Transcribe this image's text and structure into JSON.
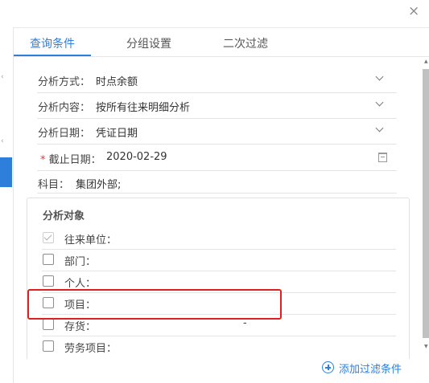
{
  "dialog": {
    "close_glyph": "×"
  },
  "tabs": [
    {
      "label": "查询条件",
      "active": true
    },
    {
      "label": "分组设置",
      "active": false
    },
    {
      "label": "二次过滤",
      "active": false
    }
  ],
  "form": {
    "rows": [
      {
        "label": "分析方式：",
        "value": "时点余额",
        "control": "dropdown"
      },
      {
        "label": "分析内容：",
        "value": "按所有往来明细分析",
        "control": "dropdown"
      },
      {
        "label": "分析日期：",
        "value": "凭证日期",
        "control": "dropdown"
      },
      {
        "required_mark": "*",
        "label": "截止日期：",
        "value": "2020-02-29",
        "control": "date",
        "icon": "calendar-icon"
      },
      {
        "label": "科目：",
        "value": "集团外部;",
        "control": "text"
      }
    ]
  },
  "analysis_objects": {
    "title": "分析对象",
    "items": [
      {
        "label": "往来单位：",
        "checked": true,
        "disabled": true
      },
      {
        "label": "部门：",
        "checked": false
      },
      {
        "label": "个人：",
        "checked": false
      },
      {
        "label": "项目：",
        "checked": false,
        "highlighted": true
      },
      {
        "label": "存货：",
        "checked": false,
        "extra": "-"
      },
      {
        "label": "劳务项目：",
        "checked": false
      }
    ]
  },
  "footer": {
    "add_filter_label": "添加过滤条件",
    "icon": "plus-circle-icon"
  },
  "colors": {
    "accent": "#2e7fdc",
    "highlight": "#e02020",
    "required": "#e53935"
  }
}
